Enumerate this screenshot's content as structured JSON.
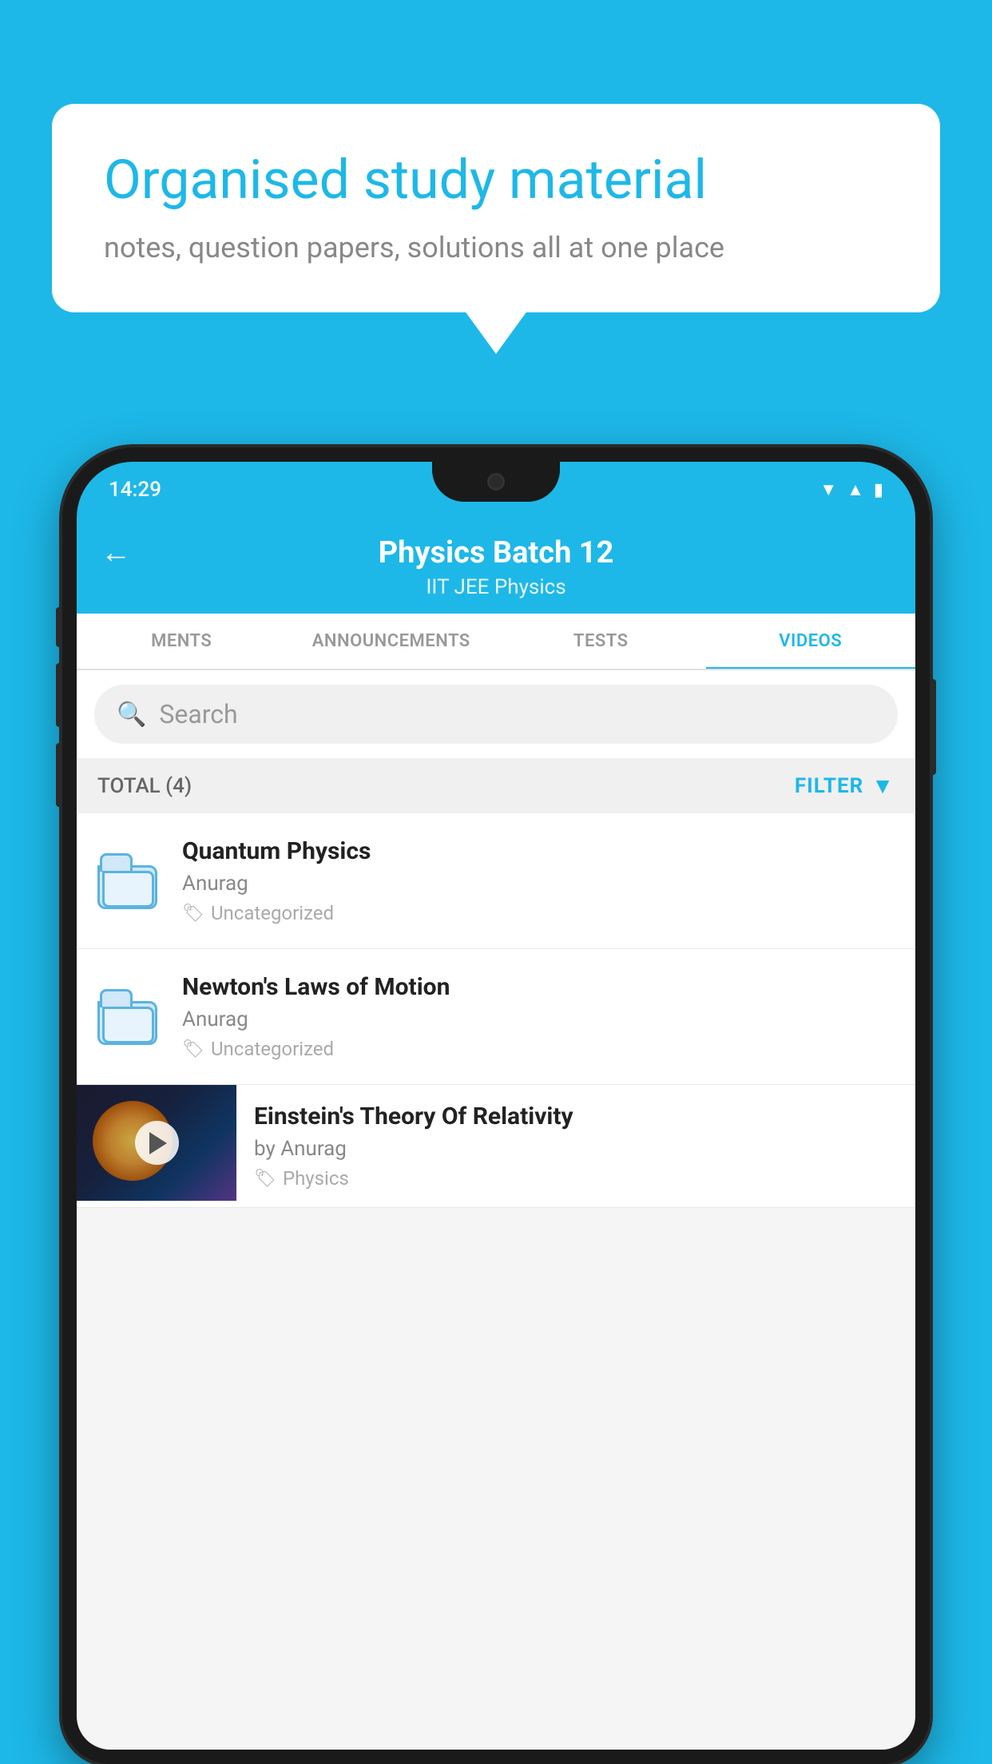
{
  "background_color": "#1DB8E8",
  "speech_bubble": {
    "title": "Organised study material",
    "subtitle": "notes, question papers, solutions all at one place"
  },
  "phone": {
    "status_bar": {
      "time": "14:29",
      "icons": [
        "wifi",
        "signal",
        "battery"
      ]
    },
    "header": {
      "back_label": "←",
      "title": "Physics Batch 12",
      "subtitle": "IIT JEE   Physics"
    },
    "tabs": [
      {
        "label": "MENTS",
        "active": false
      },
      {
        "label": "ANNOUNCEMENTS",
        "active": false
      },
      {
        "label": "TESTS",
        "active": false
      },
      {
        "label": "VIDEOS",
        "active": true
      }
    ],
    "search": {
      "placeholder": "Search"
    },
    "filter": {
      "total_label": "TOTAL (4)",
      "filter_label": "FILTER"
    },
    "list_items": [
      {
        "title": "Quantum Physics",
        "author": "Anurag",
        "tag": "Uncategorized",
        "type": "folder"
      },
      {
        "title": "Newton's Laws of Motion",
        "author": "Anurag",
        "tag": "Uncategorized",
        "type": "folder"
      },
      {
        "title": "Einstein's Theory Of Relativity",
        "author": "by Anurag",
        "tag": "Physics",
        "type": "video"
      }
    ]
  }
}
